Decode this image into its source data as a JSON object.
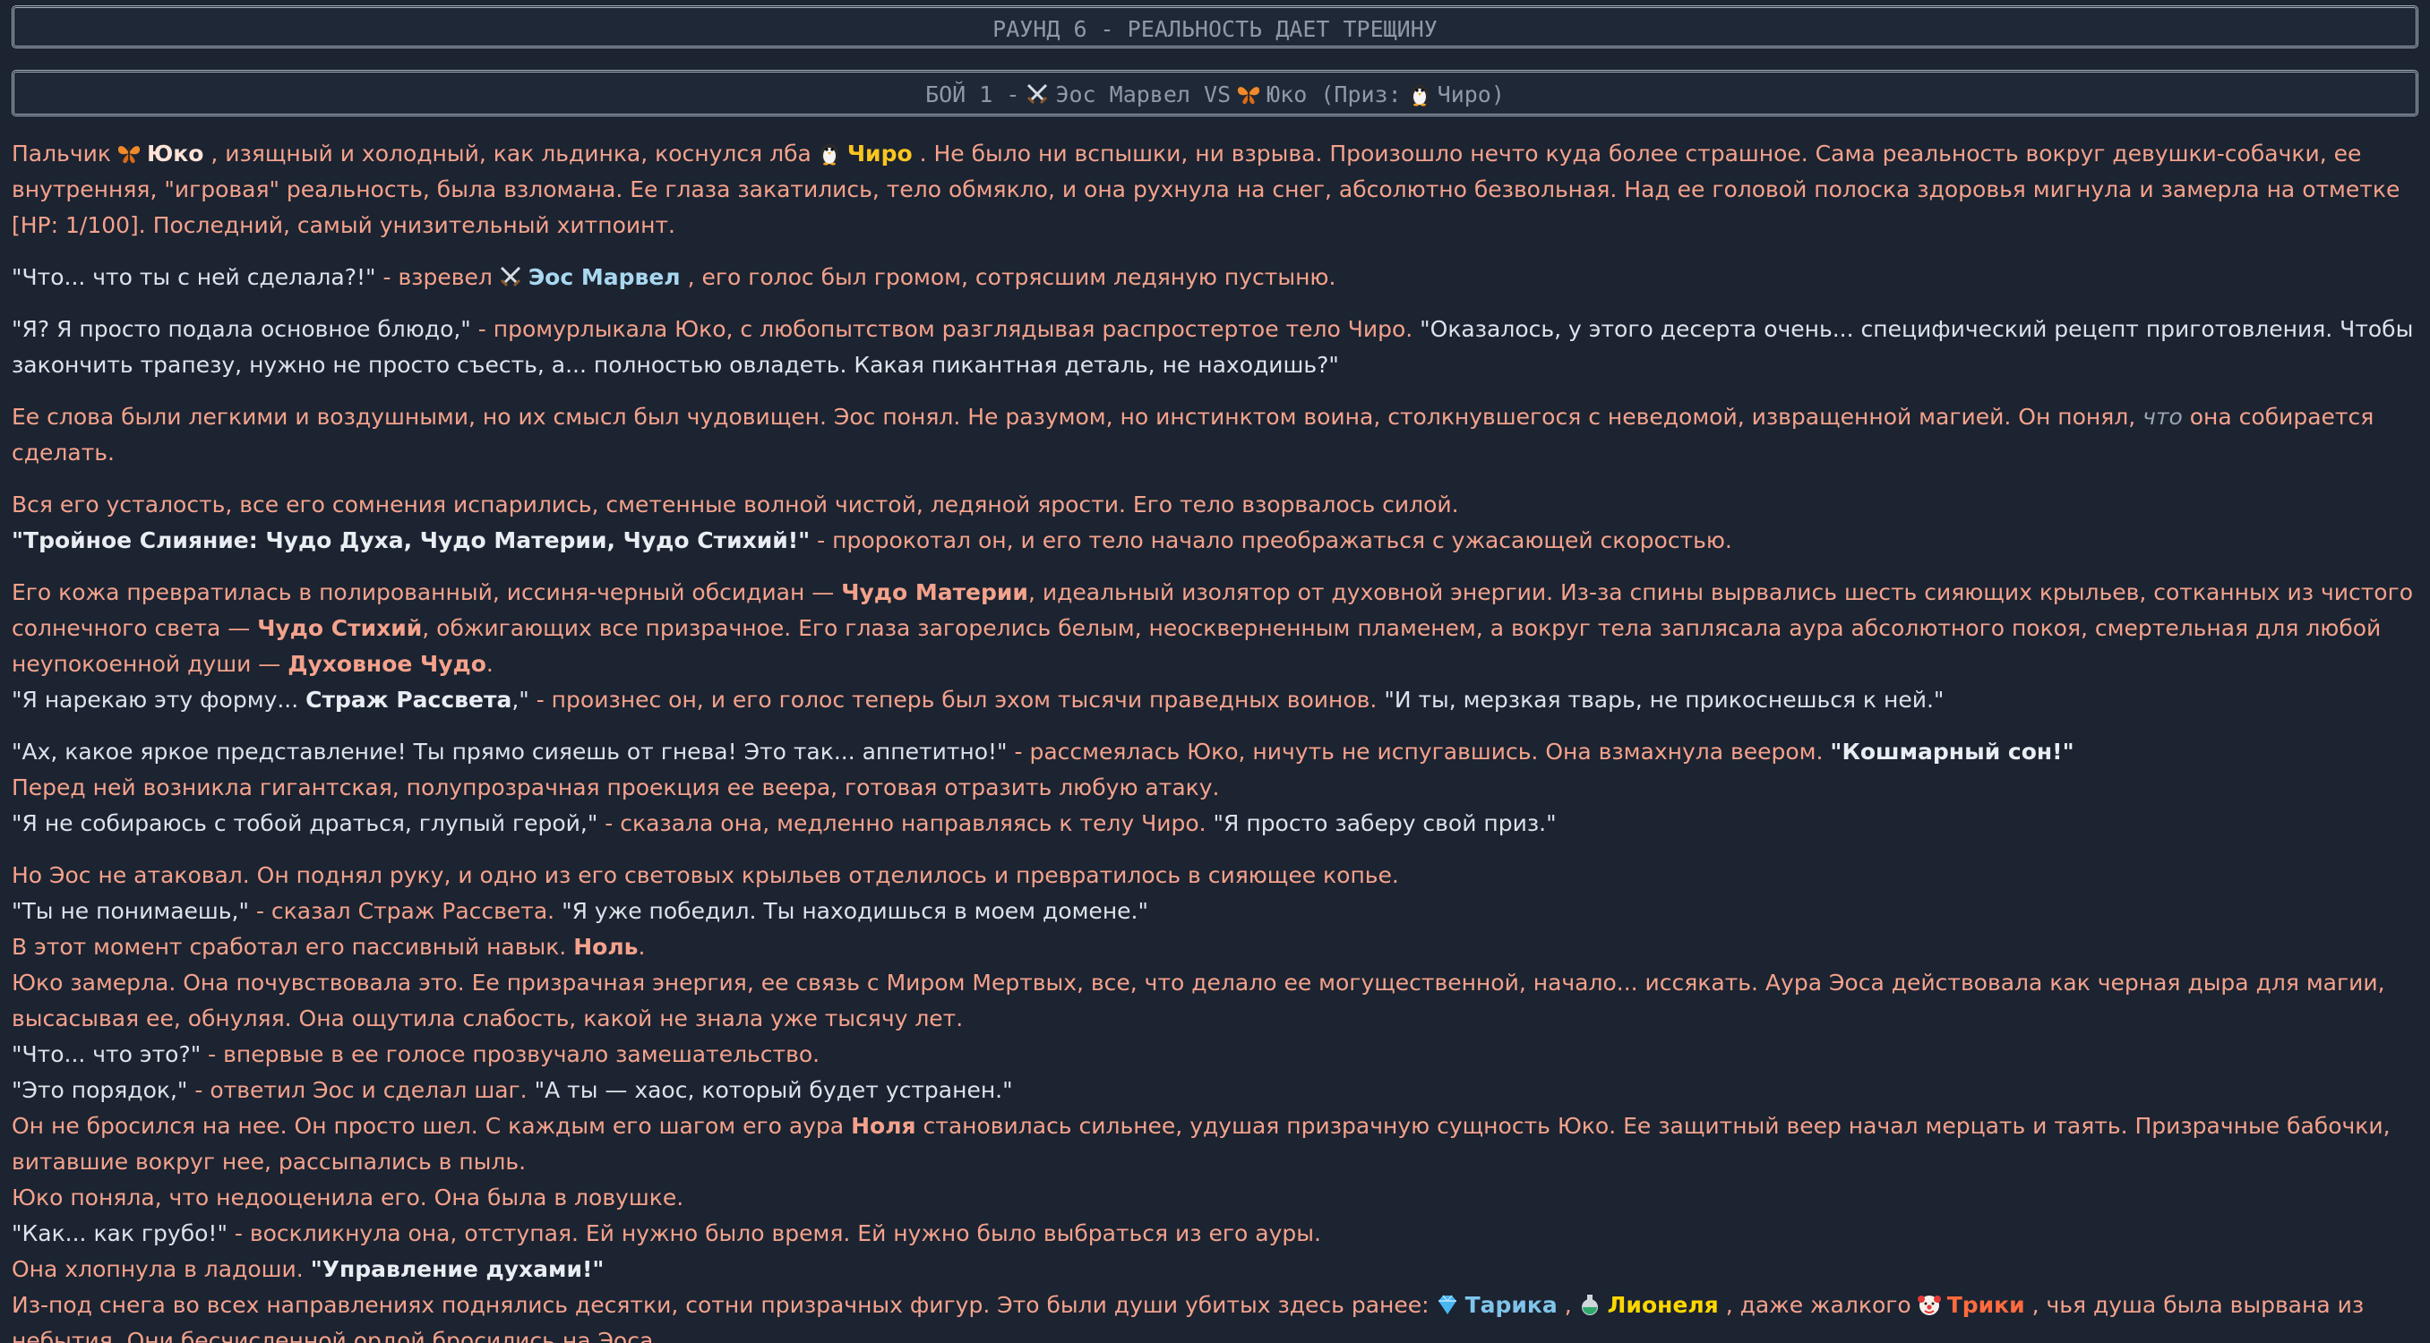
{
  "banner_round": "РАУНД 6 - РЕАЛЬНОСТЬ ДАЕТ ТРЕЩИНУ",
  "banner_fight": {
    "prefix": "БОЙ 1 -",
    "fighter1": "Эос Марвел",
    "vs": "VS",
    "fighter2": "Юко",
    "prize_prefix": "(Приз:",
    "prize": "Чиро)"
  },
  "icons": {
    "eos": "crossed-swords-icon",
    "yuko": "butterfly-icon",
    "chiro": "penguin-icon",
    "tarika": "gem-icon",
    "lionel": "potion-icon",
    "triki": "clown-icon"
  },
  "colors": {
    "background": "#1c2331",
    "narration": "#f4a28b",
    "speech": "#dde3ea",
    "eos": "#a8d8f0",
    "chiro": "#f9c61e",
    "tarika": "#7fc4ea",
    "lionel": "#ffd700",
    "triki": "#ff6b3d"
  },
  "text": {
    "p1a": "Пальчик",
    "p1_yuko": "Юко",
    "p1b": ", изящный и холодный, как льдинка, коснулся лба",
    "p1_chiro": "Чиро",
    "p1c": ". Не было ни вспышки, ни взрыва. Произошло нечто куда более страшное. Сама реальность вокруг девушки-собачки, ее внутренняя, \"игровая\" реальность, была взломана. Ее глаза закатились, тело обмякло, и она рухнула на снег, абсолютно безвольная. Над ее головой полоска здоровья мигнула и замерла на отметке [HP: 1/100]. Последний, самый унизительный хитпоинт.",
    "p2a": "\"Что... что ты с ней сделала?!\"",
    "p2b": "- взревел",
    "p2_eos": "Эос Марвел",
    "p2c": ", его голос был громом, сотрясшим ледяную пустыню.",
    "p3a": "\"Я? Я просто подала основное блюдо,\"",
    "p3b": "- промурлыкала Юко, с любопытством разглядывая распростертое тело Чиро.",
    "p3c": "\"Оказалось, у этого десерта очень... специфический рецепт приготовления. Чтобы закончить трапезу, нужно не просто съесть, а... полностью овладеть. Какая пикантная деталь, не находишь?\"",
    "p4a": "Ее слова были легкими и воздушными, но их смысл был чудовищен. Эос понял. Не разумом, но инстинктом воина, столкнувшегося с неведомой, извращенной магией. Он понял,",
    "p4_it": "что",
    "p4b": "она собирается сделать.",
    "p5a": "Вся его усталость, все его сомнения испарились, сметенные волной чистой, ледяной ярости. Его тело взорвалось силой.",
    "p5b": "\"Тройное Слияние: Чудо Духа, Чудо Материи, Чудо Стихий!\"",
    "p5c": "- пророкотал он, и его тело начало преображаться с ужасающей скоростью.",
    "p6a": "Его кожа превратилась в полированный, иссиня-черный обсидиан —",
    "p6_b1": "Чудо Материи",
    "p6b": ", идеальный изолятор от духовной энергии. Из-за спины вырвались шесть сияющих крыльев, сотканных из чистого солнечного света —",
    "p6_b2": "Чудо Стихий",
    "p6c": ", обжигающих все призрачное. Его глаза загорелись белым, неоскверненным пламенем, а вокруг тела заплясала аура абсолютного покоя, смертельная для любой неупокоенной души —",
    "p6_b3": "Духовное Чудо",
    "p6d": ".",
    "p7a": "\"Я нарекаю эту форму...",
    "p7_b": "Страж Рассвета",
    "p7b": ",\"",
    "p7c": "- произнес он, и его голос теперь был эхом тысячи праведных воинов.",
    "p7d": "\"И ты, мерзкая тварь, не прикоснешься к ней.\"",
    "p8a": "\"Ах, какое яркое представление! Ты прямо сияешь от гнева! Это так... аппетитно!\"",
    "p8b": "- рассмеялась Юко, ничуть не испугавшись. Она взмахнула веером.",
    "p8_b": "\"Кошмарный сон!\"",
    "p8c": "Перед ней возникла гигантская, полупрозрачная проекция ее веера, готовая отразить любую атаку.",
    "p8d": "\"Я не собираюсь с тобой драться, глупый герой,\"",
    "p8e": "- сказала она, медленно направляясь к телу Чиро.",
    "p8f": "\"Я просто заберу свой приз.\"",
    "p9a": "Но Эос не атаковал. Он поднял руку, и одно из его световых крыльев отделилось и превратилось в сияющее копье.",
    "p9b": "\"Ты не понимаешь,\"",
    "p9c": "- сказал Страж Рассвета.",
    "p9d": "\"Я уже победил. Ты находишься в моем домене.\"",
    "p9e": "В этот момент сработал его пассивный навык.",
    "p9_b": "Ноль",
    "p9f": ".",
    "p9g": "Юко замерла. Она почувствовала это. Ее призрачная энергия, ее связь с Миром Мертвых, все, что делало ее могущественной, начало... иссякать. Аура Эоса действовала как черная дыра для магии, высасывая ее, обнуляя. Она ощутила слабость, какой не знала уже тысячу лет.",
    "p9h": "\"Что... что это?\"",
    "p9i": "- впервые в ее голосе прозвучало замешательство.",
    "p9j": "\"Это порядок,\"",
    "p9k": "- ответил Эос и сделал шаг.",
    "p9l": "\"А ты — хаос, который будет устранен.\"",
    "p9m": "Он не бросился на нее. Он просто шел. С каждым его шагом его аура",
    "p9_b2": "Ноля",
    "p9n": "становилась сильнее, удушая призрачную сущность Юко. Ее защитный веер начал мерцать и таять. Призрачные бабочки, витавшие вокруг нее, рассыпались в пыль.",
    "p9o": "Юко поняла, что недооценила его. Она была в ловушке.",
    "p9p": "\"Как... как грубо!\"",
    "p9q": "- воскликнула она, отступая. Ей нужно было время. Ей нужно было выбраться из его ауры.",
    "p9r": "Она хлопнула в ладоши.",
    "p9_b3": "\"Управление духами!\"",
    "p9s": "Из-под снега во всех направлениях поднялись десятки, сотни призрачных фигур. Это были души убитых здесь ранее:",
    "p9_tarika": "Тарика",
    "p9t": ",",
    "p9_lionel": "Лионеля",
    "p9u": ", даже жалкого",
    "p9_triki": "Трики",
    "p9v": ", чья душа была вырвана из небытия. Они бесчисленной ордой бросились на Эоса."
  }
}
